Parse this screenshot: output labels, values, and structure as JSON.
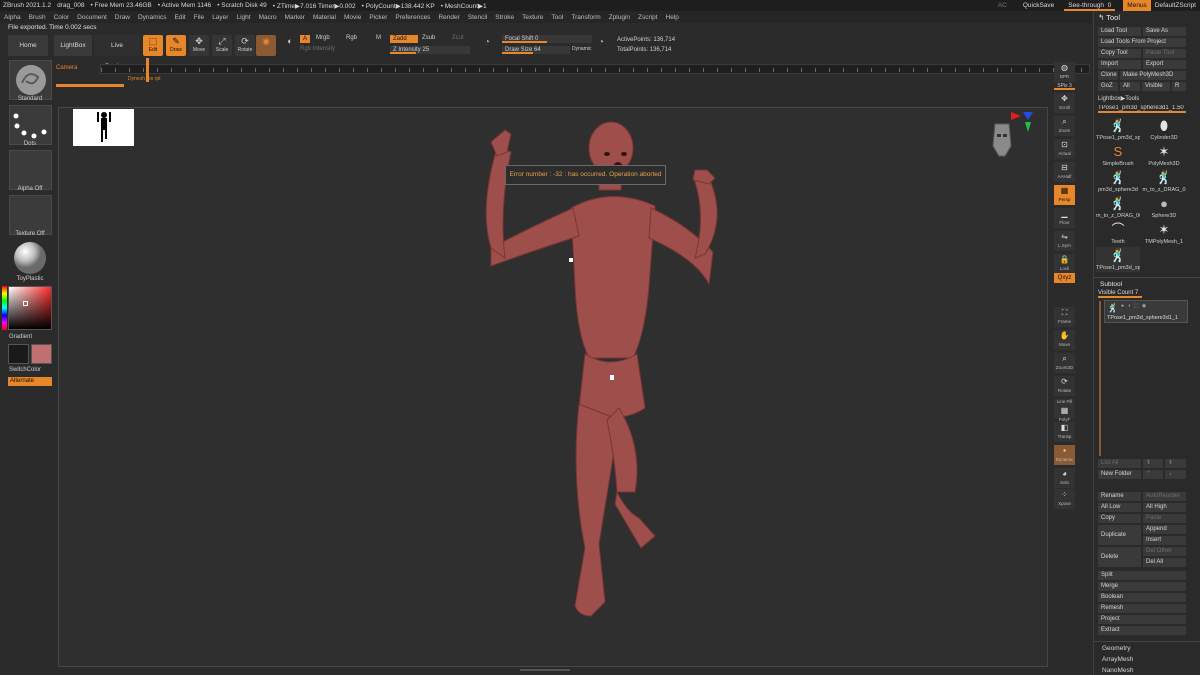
{
  "titlebar": {
    "items": [
      "ZBrush 2021.1.2",
      "drag_008",
      "• Free Mem 23.46GB",
      "• Active Mem 1146",
      "• Scratch Disk 49",
      "• ZTime▶7.016 Timer▶0.002",
      "• PolyCount▶138.442 KP",
      "• MeshCount▶1"
    ],
    "right": {
      "ac": "AC",
      "quicksave": "QuickSave",
      "seethrough": "See-through",
      "seethrough_value": "0",
      "menus": "Menus",
      "script": "DefaultZScript"
    }
  },
  "menubar": [
    "Alpha",
    "Brush",
    "Color",
    "Document",
    "Draw",
    "Dynamics",
    "Edit",
    "File",
    "Layer",
    "Light",
    "Macro",
    "Marker",
    "Material",
    "Movie",
    "Picker",
    "Preferences",
    "Render",
    "Stencil",
    "Stroke",
    "Texture",
    "Tool",
    "Transform",
    "Zplugin",
    "Zscript",
    "Help"
  ],
  "status": "File exported. Time 0.002 secs",
  "shelf": {
    "home_page": "Home Page",
    "lightbox": "LightBox",
    "live_boolean": "Live Boolean",
    "edit": "Edit",
    "draw": "Draw",
    "move": "Move",
    "scale": "Scale",
    "rotate": "Rotate",
    "a": "A",
    "mrgb": "Mrgb",
    "rgb": "Rgb",
    "m": "M",
    "rgb_intensity": "Rgb Intensity",
    "zadd": "Zadd",
    "zsub": "Zsub",
    "zcut": "Zcut",
    "z_intensity": "Z Intensity",
    "z_intensity_value": "25",
    "focal_shift": "Focal Shift",
    "focal_shift_value": "0",
    "draw_size": "Draw Size",
    "draw_size_value": "64",
    "dynamic": "Dynamic",
    "active_points": "ActivePoints: 136,714",
    "total_points": "TotalPoints: 136,714"
  },
  "timeline": {
    "camera": "Camera",
    "small": "Dynesh res rpt"
  },
  "lefttray": {
    "standard": "Standard",
    "dots": "Dots",
    "alpha_off": "Alpha Off",
    "texture_off": "Texture Off",
    "material": "ToyPlastic",
    "gradient": "Gradient",
    "switch_color": "SwitchColor",
    "alternate": "Alternate",
    "main_color": "#1a1a1a",
    "secondary_color": "#c07070"
  },
  "canvas": {
    "error": "Error number : -32 : has occurred. Operation aborted"
  },
  "rstrip": {
    "bpr": "BPR",
    "spix": "SPix",
    "spix_value": "3",
    "scroll": "Scroll",
    "zoom": "Zoom",
    "actual": "Actual",
    "aahalf": "AAHalf",
    "persp": "Persp",
    "floor": "Floor",
    "lsym": "L.Sym",
    "lock": "Lock",
    "qxyz": "Qxyz",
    "frame": "Frame",
    "move": "Move",
    "zoom3d": "Zoom3D",
    "rotate": "Rotate",
    "linefill": "Line Fill",
    "polyf": "PolyF",
    "transp": "Transp",
    "solo": "Solo",
    "xpose": "Xpose",
    "dynamic": "Dynamic"
  },
  "palette": {
    "title": "Tool",
    "load_tool": "Load Tool",
    "save_as": "Save As",
    "load_from_project": "Load Tools From Project",
    "copy_tool": "Copy Tool",
    "paste_tool": "Paste Tool",
    "import": "Import",
    "export": "Export",
    "clone": "Clone",
    "make_polymesh": "Make PolyMesh3D",
    "goz": "GoZ",
    "all": "All",
    "visible": "Visible",
    "r": "R",
    "lightbox_tools": "Lightbox▶Tools",
    "current_tool": "TPose1_pm3d_sphere3d1_1",
    "current_value": "50",
    "tools": [
      {
        "name": "TPose1_pm3d_sp",
        "icon": "🕺"
      },
      {
        "name": "Cylinder3D",
        "icon": "⬮"
      },
      {
        "name": "SimpleBrush",
        "icon": "S"
      },
      {
        "name": "PolyMesh3D",
        "icon": "✶"
      },
      {
        "name": "pm3d_sphere3d",
        "icon": "🕺"
      },
      {
        "name": "m_to_z_DRAG_0",
        "icon": "🕺"
      },
      {
        "name": "m_to_z_DRAG_00",
        "icon": "🕺"
      },
      {
        "name": "Sphere3D",
        "icon": "●"
      },
      {
        "name": "Teeth",
        "icon": "⌒"
      },
      {
        "name": "TMPolyMesh_1",
        "icon": "✶"
      },
      {
        "name": "TPose1_pm3d_sp",
        "icon": "🕺"
      }
    ],
    "subtool": "Subtool",
    "visible_count": "Visible Count 7",
    "subtool_item": "TPose1_pm3d_sphere3d1_1",
    "list_all": "List All",
    "new_folder": "New Folder",
    "rename": "Rename",
    "autoreorder": "AutoReorder",
    "all_low": "All Low",
    "all_high": "All High",
    "copy": "Copy",
    "paste": "Paste",
    "duplicate": "Duplicate",
    "append": "Append",
    "insert": "Insert",
    "delete": "Delete",
    "del_other": "Del Other",
    "del_all": "Del All",
    "split": "Split",
    "merge": "Merge",
    "boolean": "Boolean",
    "remesh": "Remesh",
    "project": "Project",
    "extract": "Extract",
    "geometry": "Geometry",
    "arraymesh": "ArrayMesh",
    "nanomesh": "NanoMesh",
    "accent": "#e8862a"
  }
}
